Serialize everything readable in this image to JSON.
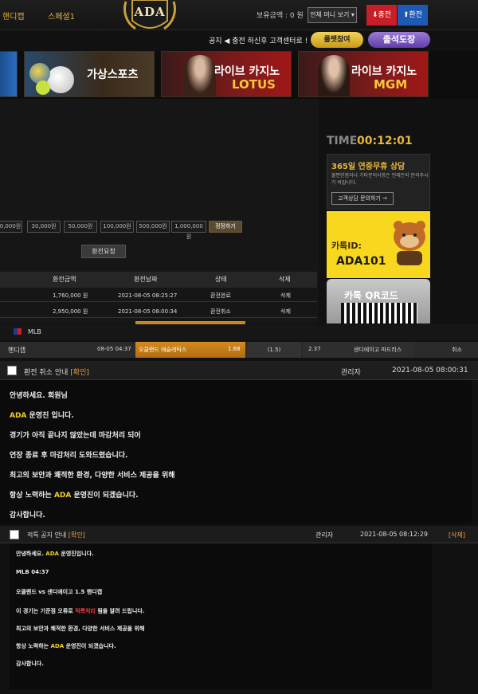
{
  "header": {
    "nav_handicap": "핸디캡",
    "nav_special": "스페셜1",
    "logo_text": "ADA",
    "balance_label": "보유금액 : 0 원",
    "money_dropdown": "전체 머니 보기",
    "charge_button": "충전",
    "exchange_button": "환전"
  },
  "notice": {
    "text": "공지 ◀ 충전 하신후 고객센터로 !",
    "roulette_button": "룰렛참여",
    "attendance_button": "출석도장"
  },
  "banners": [
    {
      "label": "가상스포츠",
      "sub": ""
    },
    {
      "label": "라이브 카지노",
      "sub": "LOTUS"
    },
    {
      "label": "라이브 카지노",
      "sub": "MGM"
    }
  ],
  "exchange": {
    "chips": [
      "0,000원",
      "30,000원",
      "50,000원",
      "100,000원",
      "500,000원",
      "1,000,000원"
    ],
    "reset_button": "정정하기",
    "request_button": "환전요청",
    "table": {
      "headers": [
        "환전금액",
        "환전날짜",
        "상태",
        "삭제"
      ],
      "rows": [
        {
          "amount": "1,760,000 원",
          "date": "2021-08-05 08:25:27",
          "status": "환전완료",
          "delete": "삭제"
        },
        {
          "amount": "2,950,000 원",
          "date": "2021-08-05 08:00:34",
          "status": "환전취소",
          "delete": "삭제"
        }
      ]
    }
  },
  "sidebar": {
    "time_label": "TIME",
    "time_value": "00:12:01",
    "cs_title": "365일 연중무휴 상담",
    "cs_desc": "불편한점이나 기타문의사항은 언제든지 문의주시기 바랍니다.",
    "cs_button": "고객상담 문의하기 →",
    "kakao_id_label": "카톡ID:",
    "kakao_id": "ADA101",
    "qr_label": "카톡 QR코드"
  },
  "bet": {
    "league": "MLB",
    "type": "핸디캡",
    "time": "08-05 04:37",
    "home_team": "오클랜드 애슬레틱스",
    "home_odds": "1.68",
    "line": "(1.5)",
    "away_odds": "2.37",
    "away_team": "샌디에이고 파드리스",
    "status": "취소"
  },
  "message1": {
    "title": "환전 취소 안내",
    "confirm": "[확인]",
    "author": "관리자",
    "date": "2021-08-05 08:00:31",
    "lines": [
      "안녕하세요. 회원님",
      "ADA",
      " 운영진 입니다.",
      "경기가 아직 끝나지 않았는데 마감처리 되어",
      "연장 종료 후 마감처리 도와드렸습니다.",
      "최고의 보안과 쾌적한 환경, 다양한 서비스 제공을 위해",
      "항상 노력하는 ",
      " 운영진이 되겠습니다.",
      "감사합니다."
    ]
  },
  "message2": {
    "title": "적특 공지 안내",
    "confirm": "[확인]",
    "author": "관리자",
    "date": "2021-08-05 08:12:29",
    "delete": "[삭제]",
    "lines": [
      "안녕하세요. ",
      "ADA",
      " 운영진입니다.",
      "MLB 04:37",
      "오클랜드 vs 샌디에이고 1.5 핸디캡",
      "이 경기는 기준점 오류로 ",
      "적특처리",
      " 됨을 알려 드립니다.",
      "최고의 보안과 쾌적한 환경, 다양한 서비스 제공을 위해",
      "항상 노력하는 ",
      " 운영진이 되겠습니다.",
      "감사합니다."
    ]
  },
  "colors": {
    "gold": "#e8b83a",
    "charge": "#c81e28",
    "exchange": "#1e5ab4",
    "bet_selected": "#c8861e",
    "highlight_yellow": "#f4d21e",
    "highlight_blue": "#3aa0ff",
    "highlight_red": "#ff3a3a"
  }
}
